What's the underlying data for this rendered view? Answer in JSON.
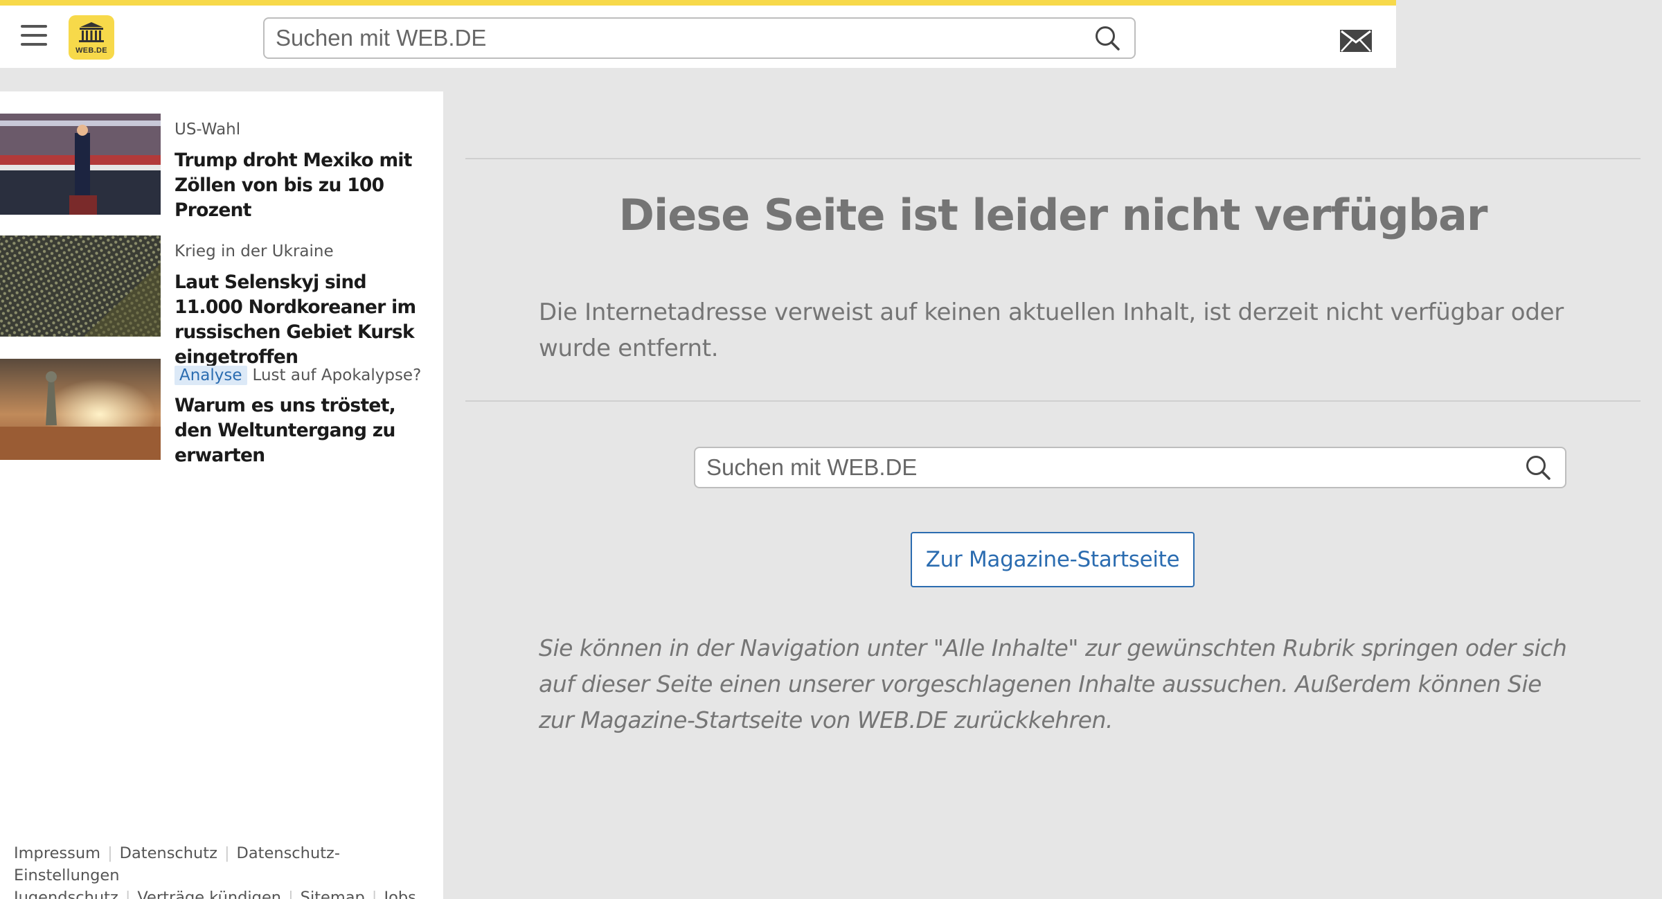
{
  "header": {
    "logo_text": "WEB.DE",
    "search_placeholder": "Suchen mit WEB.DE"
  },
  "teasers": [
    {
      "kicker": "US-Wahl",
      "badge": "",
      "headline": "Trump droht Mexiko mit Zöllen von bis zu 100 Prozent"
    },
    {
      "kicker": "Krieg in der Ukraine",
      "badge": "",
      "headline": "Laut Selenskyj sind 11.000 Nordkoreaner im russischen Gebiet Kursk eingetroffen"
    },
    {
      "kicker": "Lust auf Apokalypse?",
      "badge": "Analyse",
      "headline": "Warum es uns tröstet, den Weltuntergang zu erwarten"
    }
  ],
  "footer": {
    "links": [
      "Impressum",
      "Datenschutz",
      "Datenschutz-Einstellungen",
      "Jugendschutz",
      "Verträge kündigen",
      "Sitemap",
      "Jobs"
    ]
  },
  "main": {
    "title": "Diese Seite ist leider nicht verfügbar",
    "description": "Die Internetadresse verweist auf keinen aktuellen Inhalt, ist derzeit nicht verfügbar oder wurde entfernt.",
    "search_placeholder": "Suchen mit WEB.DE",
    "button_label": "Zur Magazine-Startseite",
    "info": "Sie können in der Navigation unter \"Alle Inhalte\" zur gewünschten Rubrik springen oder sich auf dieser Seite einen unserer vorgeschlagenen Inhalte aussuchen. Außerdem können Sie zur Magazine-Startseite von WEB.DE zurückkehren."
  },
  "colors": {
    "accent_yellow": "#f7d94a",
    "link_blue": "#2b6cb0",
    "text_gray": "#757575",
    "page_bg": "#e6e6e6"
  },
  "icons": [
    "menu-icon",
    "webde-logo",
    "search-icon",
    "mail-icon"
  ]
}
